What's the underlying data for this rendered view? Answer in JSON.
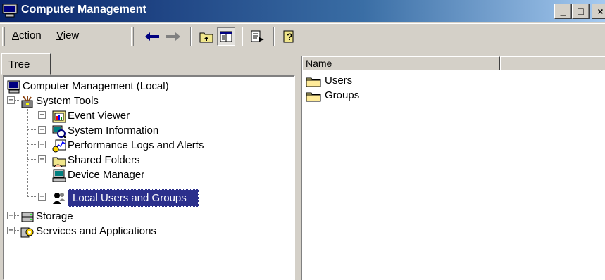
{
  "window": {
    "title": "Computer Management",
    "min_label": "_",
    "max_label": "□",
    "close_label": "×"
  },
  "menu": {
    "action_label": "Action",
    "action_mnemonic": "A",
    "view_label": "View",
    "view_mnemonic": "V"
  },
  "toolbar": {
    "buttons": [
      "back-icon",
      "forward-icon",
      "up-folder-icon",
      "show-hide-tree-icon",
      "export-list-icon",
      "help-icon"
    ]
  },
  "tree": {
    "tab_label": "Tree",
    "root": "Computer Management (Local)",
    "system_tools": "System Tools",
    "event_viewer": "Event Viewer",
    "system_information": "System Information",
    "performance_logs": "Performance Logs and Alerts",
    "shared_folders": "Shared Folders",
    "device_manager": "Device Manager",
    "local_users": "Local Users and Groups",
    "storage": "Storage",
    "services": "Services and Applications"
  },
  "list": {
    "columns": [
      "Name",
      ""
    ],
    "items": [
      "Users",
      "Groups"
    ]
  },
  "colors": {
    "selection": "#2b2f8c",
    "titlebar": "#0a246a",
    "face": "#d4d0c8"
  }
}
